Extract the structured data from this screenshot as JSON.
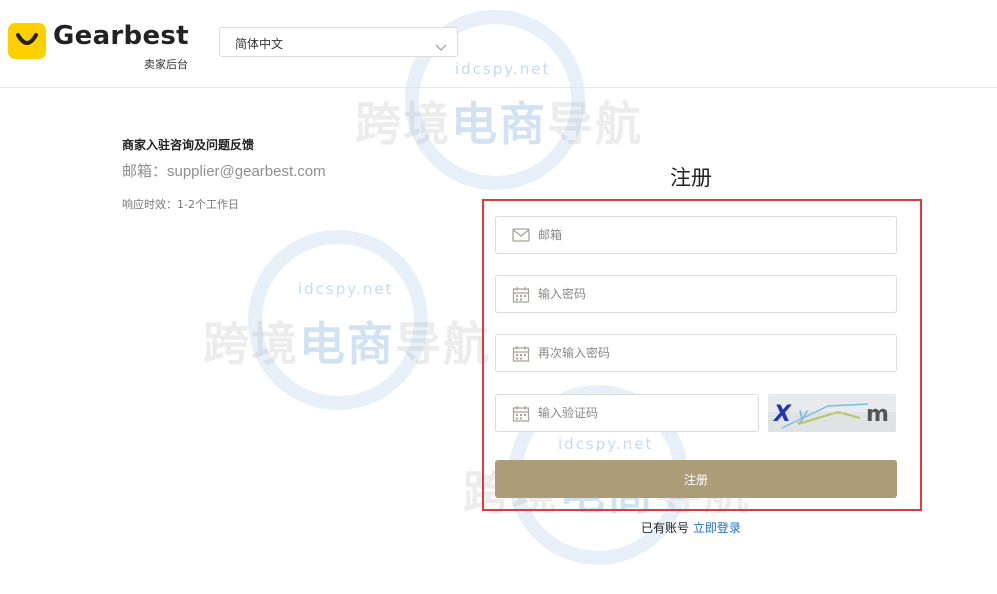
{
  "header": {
    "logo_text": "Gearbest",
    "logo_subtitle": "卖家后台",
    "language": {
      "selected": "简体中文"
    }
  },
  "contact": {
    "title": "商家入驻咨询及问题反馈",
    "email_line": "邮箱：supplier@gearbest.com",
    "response_time": "响应时效：1-2个工作日"
  },
  "register": {
    "title": "注册",
    "email_placeholder": "邮箱",
    "password_placeholder": "输入密码",
    "confirm_password_placeholder": "再次输入密码",
    "captcha_placeholder": "输入验证码",
    "submit_label": "注册",
    "has_account_text": "已有账号",
    "login_link": "立即登录"
  },
  "watermark": {
    "url": "idcspy.net",
    "text_a": "跨境",
    "text_b": "电商",
    "text_c": "导航"
  },
  "colors": {
    "brand_yellow": "#ffd000",
    "submit_bg": "#aa9d78",
    "highlight_border": "#e53935",
    "link_blue": "#1f6fd1"
  }
}
